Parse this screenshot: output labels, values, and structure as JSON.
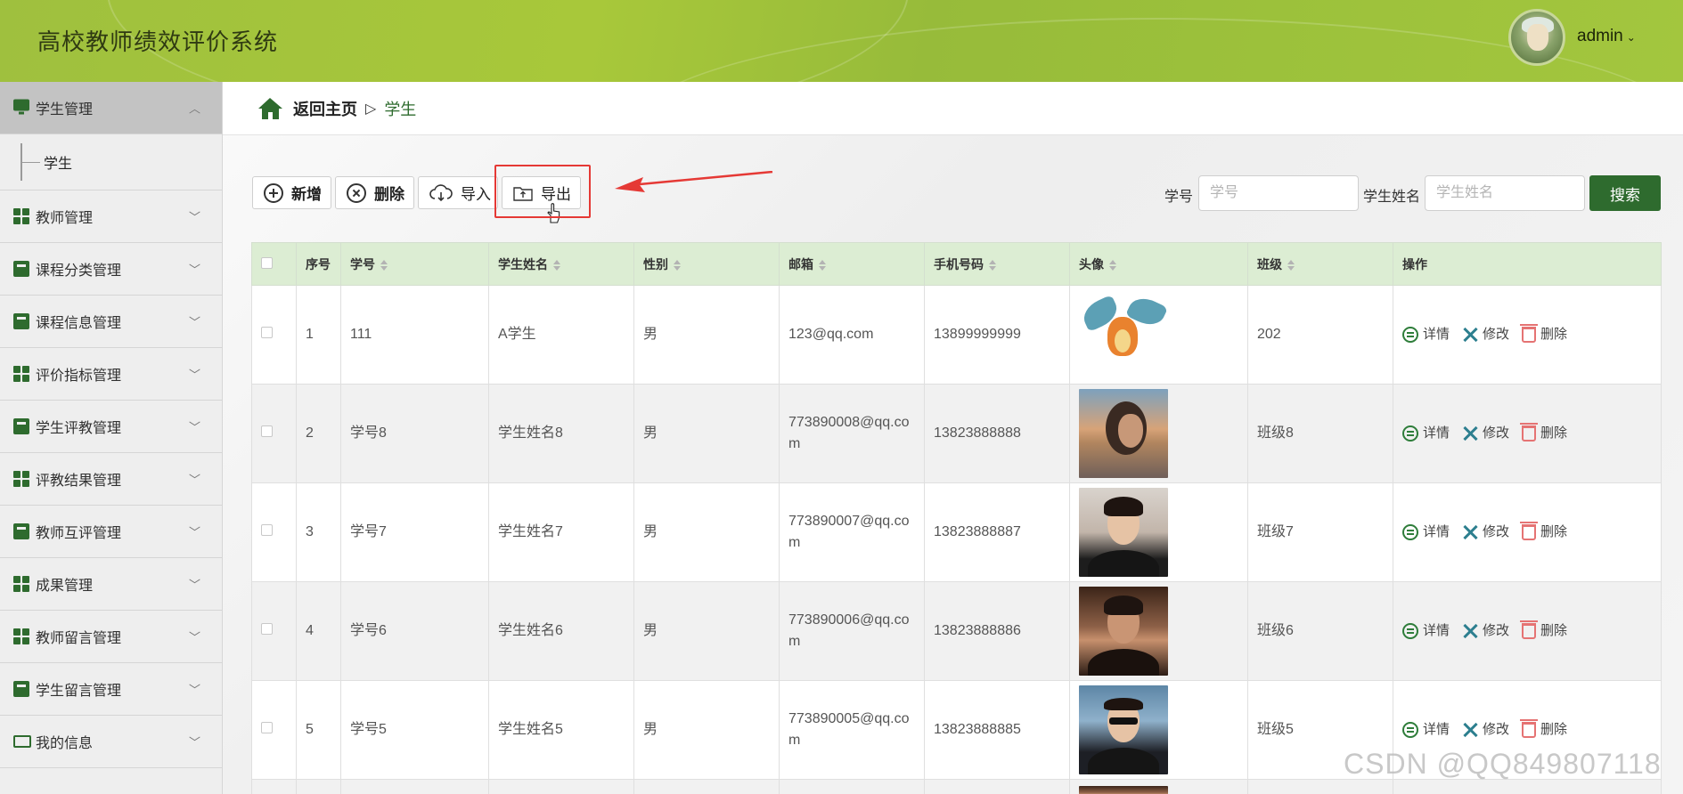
{
  "header": {
    "title": "高校教师绩效评价系统",
    "username": "admin",
    "caret": "⌄",
    "colors": {
      "bar": "#a3c63e",
      "accent": "#2e6b2e"
    }
  },
  "sidebar": {
    "items": [
      {
        "label": "学生管理",
        "icon": "monitor-icon",
        "expanded": true
      },
      {
        "label": "教师管理",
        "icon": "grid-icon"
      },
      {
        "label": "课程分类管理",
        "icon": "ticket-icon"
      },
      {
        "label": "课程信息管理",
        "icon": "briefcase-icon"
      },
      {
        "label": "评价指标管理",
        "icon": "grid-icon"
      },
      {
        "label": "学生评教管理",
        "icon": "clipboard-icon"
      },
      {
        "label": "评教结果管理",
        "icon": "grid-icon"
      },
      {
        "label": "教师互评管理",
        "icon": "chat-icon"
      },
      {
        "label": "成果管理",
        "icon": "grid-icon"
      },
      {
        "label": "教师留言管理",
        "icon": "grid-icon"
      },
      {
        "label": "学生留言管理",
        "icon": "toolbox-icon"
      },
      {
        "label": "我的信息",
        "icon": "card-icon"
      }
    ],
    "sub_items": [
      {
        "label": "学生"
      }
    ]
  },
  "breadcrumb": {
    "home": "返回主页",
    "separator": "▷",
    "current": "学生"
  },
  "toolbar": {
    "add": "新增",
    "delete": "删除",
    "import": "导入",
    "export": "导出"
  },
  "search": {
    "id_label": "学号",
    "id_placeholder": "学号",
    "name_label": "学生姓名",
    "name_placeholder": "学生姓名",
    "button": "搜索"
  },
  "table": {
    "columns": [
      "序号",
      "学号",
      "学生姓名",
      "性别",
      "邮箱",
      "手机号码",
      "头像",
      "班级",
      "操作"
    ],
    "rows": [
      {
        "index": "1",
        "student_id": "111",
        "name": "A学生",
        "gender": "男",
        "email": "123@qq.com",
        "phone": "13899999999",
        "avatar": "dragon-avatar",
        "class": "202"
      },
      {
        "index": "2",
        "student_id": "学号8",
        "name": "学生姓名8",
        "gender": "男",
        "email": "773890008@qq.com",
        "phone": "13823888888",
        "avatar": "girl-sunset-avatar",
        "class": "班级8"
      },
      {
        "index": "3",
        "student_id": "学号7",
        "name": "学生姓名7",
        "gender": "男",
        "email": "773890007@qq.com",
        "phone": "13823888887",
        "avatar": "boy-portrait-avatar",
        "class": "班级7"
      },
      {
        "index": "4",
        "student_id": "学号6",
        "name": "学生姓名6",
        "gender": "男",
        "email": "773890006@qq.com",
        "phone": "13823888886",
        "avatar": "boy-dark-avatar",
        "class": "班级6"
      },
      {
        "index": "5",
        "student_id": "学号5",
        "name": "学生姓名5",
        "gender": "男",
        "email": "773890005@qq.com",
        "phone": "13823888885",
        "avatar": "boy-sea-avatar",
        "class": "班级5"
      }
    ],
    "actions": {
      "detail": "详情",
      "edit": "修改",
      "delete": "删除"
    }
  },
  "watermark": "CSDN @QQ849807118"
}
